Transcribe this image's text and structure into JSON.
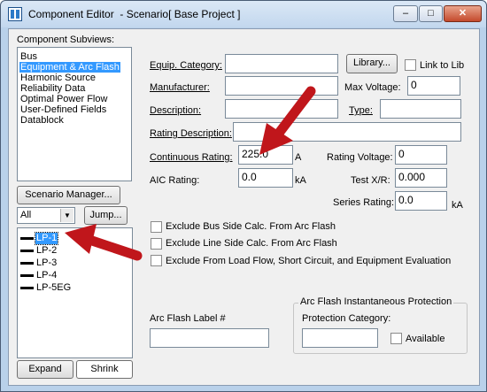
{
  "window": {
    "title": "Component Editor  - Scenario[ Base Project ]",
    "controls": {
      "minimize": "–",
      "maximize": "□",
      "close": "✕"
    }
  },
  "sidebar": {
    "subviews_label": "Component Subviews:",
    "subviews": [
      {
        "label": "Bus",
        "selected": false
      },
      {
        "label": "Equipment & Arc Flash",
        "selected": true
      },
      {
        "label": "Harmonic Source",
        "selected": false
      },
      {
        "label": "Reliability Data",
        "selected": false
      },
      {
        "label": "Optimal Power Flow",
        "selected": false
      },
      {
        "label": "User-Defined Fields",
        "selected": false
      },
      {
        "label": "Datablock",
        "selected": false
      }
    ],
    "scenario_button": "Scenario Manager...",
    "filter_value": "All",
    "jump_button": "Jump...",
    "components": [
      {
        "label": "LP-1",
        "selected": true
      },
      {
        "label": "LP-2",
        "selected": false
      },
      {
        "label": "LP-3",
        "selected": false
      },
      {
        "label": "LP-4",
        "selected": false
      },
      {
        "label": "LP-5EG",
        "selected": false
      }
    ],
    "expand_button": "Expand",
    "shrink_button": "Shrink"
  },
  "form": {
    "equip_category_label": "Equip. Category:",
    "equip_category_value": "",
    "library_button": "Library...",
    "link_to_lib_label": "Link to Lib",
    "manufacturer_label": "Manufacturer:",
    "manufacturer_value": "",
    "max_voltage_label": "Max Voltage:",
    "max_voltage_value": "0",
    "description_label": "Description:",
    "description_value": "",
    "type_label": "Type:",
    "type_value": "",
    "rating_description_label": "Rating Description:",
    "rating_description_value": "",
    "continuous_rating_label": "Continuous Rating:",
    "continuous_rating_value": "225.0",
    "continuous_rating_unit": "A",
    "rating_voltage_label": "Rating Voltage:",
    "rating_voltage_value": "0",
    "aic_rating_label": "AIC Rating:",
    "aic_rating_value": "0.0",
    "aic_rating_unit": "kA",
    "test_xr_label": "Test X/R:",
    "test_xr_value": "0.000",
    "series_rating_label": "Series Rating:",
    "series_rating_value": "0.0",
    "series_rating_unit": "kA",
    "checkbox_bus_side": "Exclude Bus Side Calc. From Arc Flash",
    "checkbox_line_side": "Exclude Line Side Calc. From Arc Flash",
    "checkbox_load_flow": "Exclude From Load Flow, Short Circuit, and Equipment Evaluation",
    "arc_flash_label_title": "Arc Flash Label #",
    "arc_flash_label_value": "",
    "protection_group_title": "Arc Flash Instantaneous Protection",
    "protection_category_label": "Protection Category:",
    "protection_category_value": "",
    "available_label": "Available"
  },
  "colors": {
    "annotation_arrow": "#c0161b",
    "selection": "#3399ff"
  }
}
